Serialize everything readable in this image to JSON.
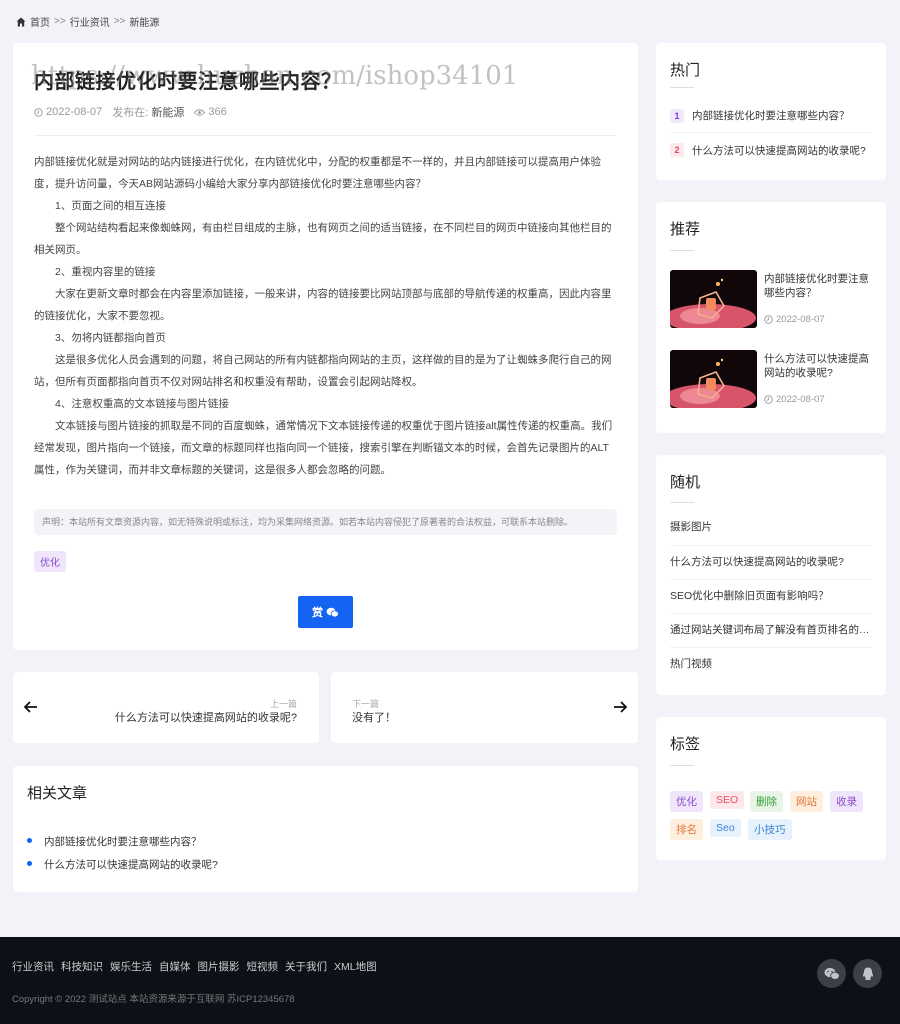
{
  "breadcrumb": {
    "home": "首页",
    "sep1": ">>",
    "cat": "行业资讯",
    "sep2": ">>",
    "sub": "新能源"
  },
  "article": {
    "title": "内部链接优化时要注意哪些内容？",
    "watermark": "https://www.huzhan.com/ishop34101",
    "date": "2022-08-07",
    "published_in_label": "发布在:",
    "category": "新能源",
    "views": "366",
    "paragraphs": [
      "内部链接优化就是对网站的站内链接进行优化，在内链优化中，分配的权重都是不一样的，并且内部链接可以提高用户体验度，提升访问量，今天AB网站源码小编给大家分享内部链接优化时要注意哪些内容？",
      "1、页面之间的相互连接",
      "整个网站结构看起来像蜘蛛网，有由栏目组成的主脉，也有网页之间的适当链接，在不同栏目的网页中链接向其他栏目的相关网页。",
      "2、重视内容里的链接",
      "大家在更新文章时都会在内容里添加链接，一般来讲，内容的链接要比网站顶部与底部的导航传递的权重高，因此内容里的链接优化，大家不要忽视。",
      "3、勿将内链都指向首页",
      "这是很多优化人员会遇到的问题，将自己网站的所有内链都指向网站的主页，这样做的目的是为了让蜘蛛多爬行自己的网站，但所有页面都指向首页不仅对网站排名和权重没有帮助，设置会引起网站降权。",
      "4、注意权重高的文本链接与图片链接",
      "文本链接与图片链接的抓取是不同的百度蜘蛛，通常情况下文本链接传递的权重优于图片链接alt属性传递的权重高。我们经常发现，图片指向一个链接，而文章的标题同样也指向同一个链接，搜索引擎在判断锚文本的时候，会首先记录图片的ALT属性，作为关键词，而并非文章标题的关键词，这是很多人都会忽略的问题。"
    ],
    "notice": "声明：本站所有文章资源内容，如无特殊说明或标注，均为采集网络资源。如若本站内容侵犯了原著者的合法权益，可联系本站删除。",
    "tag": "优化",
    "reward_label": "赏"
  },
  "post_nav": {
    "prev_label": "上一篇",
    "prev_title": "什么方法可以快速提高网站的收录呢?",
    "next_label": "下一篇",
    "next_title": "没有了！"
  },
  "related": {
    "title": "相关文章",
    "items": [
      "内部链接优化时要注意哪些内容？",
      "什么方法可以快速提高网站的收录呢?"
    ]
  },
  "sidebar": {
    "hot": {
      "title": "热门",
      "items": [
        {
          "rank": "1",
          "title": "内部链接优化时要注意哪些内容？"
        },
        {
          "rank": "2",
          "title": "什么方法可以快速提高网站的收录呢?"
        }
      ]
    },
    "recommend": {
      "title": "推荐",
      "items": [
        {
          "title": "内部链接优化时要注意哪些内容？",
          "date": "2022-08-07"
        },
        {
          "title": "什么方法可以快速提高网站的收录呢?",
          "date": "2022-08-07"
        }
      ]
    },
    "random": {
      "title": "随机",
      "items": [
        "摄影图片",
        "什么方法可以快速提高网站的收录呢?",
        "SEO优化中删除旧页面有影响吗？",
        "通过网站关键词布局了解没有首页排名的原...",
        "热门视频"
      ]
    },
    "tags": {
      "title": "标签",
      "items": [
        "优化",
        "SEO",
        "删除",
        "网站",
        "收录",
        "排名",
        "Seo",
        "小技巧"
      ]
    }
  },
  "footer": {
    "links": [
      "行业资讯",
      "科技知识",
      "娱乐生活",
      "自媒体",
      "图片摄影",
      "短视频",
      "关于我们",
      "XML地图"
    ],
    "copyright": "Copyright © 2022 测试站点 本站资源来源于互联网 苏ICP12345678"
  },
  "colors": {
    "accent": "#1463f3",
    "footer_bg": "#0d1117",
    "page_bg": "#f1f3f8"
  }
}
